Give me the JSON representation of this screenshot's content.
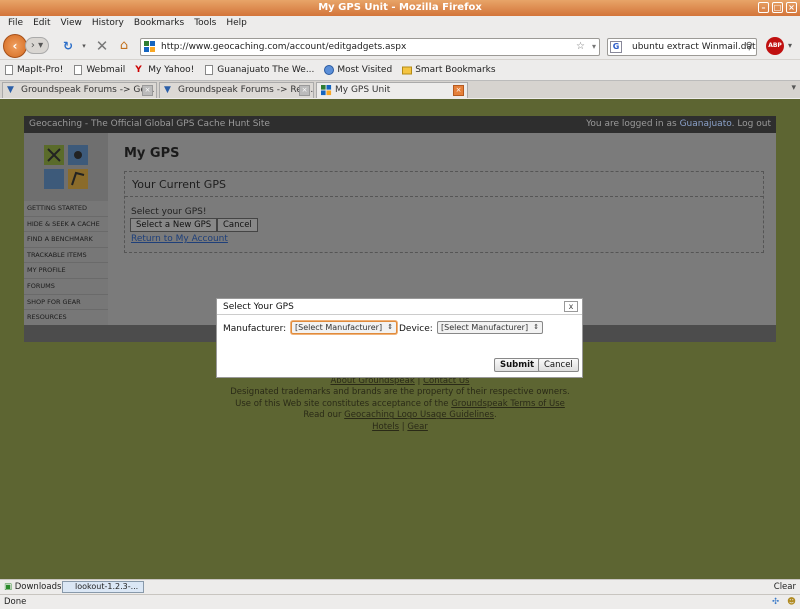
{
  "window": {
    "title": "My GPS Unit - Mozilla Firefox"
  },
  "menu": [
    "File",
    "Edit",
    "View",
    "History",
    "Bookmarks",
    "Tools",
    "Help"
  ],
  "toolbar": {
    "url": "http://www.geocaching.com/account/editgadgets.aspx",
    "search": "ubuntu extract Winmail.dat",
    "abp_label": "ABP"
  },
  "bookmarks": [
    {
      "label": "MapIt-Pro!",
      "icon": "page-icon"
    },
    {
      "label": "Webmail",
      "icon": "page-icon"
    },
    {
      "label": "My Yahoo!",
      "icon": "yahoo-icon"
    },
    {
      "label": "Guanajuato The We...",
      "icon": "page-icon"
    },
    {
      "label": "Most Visited",
      "icon": "globe-icon"
    },
    {
      "label": "Smart Bookmarks",
      "icon": "folder-icon"
    }
  ],
  "tabs": [
    {
      "label": "Groundspeak Forums -> Ge...",
      "active": false
    },
    {
      "label": "Groundspeak Forums -> Rep...",
      "active": false
    },
    {
      "label": "My GPS Unit",
      "active": true
    }
  ],
  "site": {
    "header_left": "Geocaching - The Official Global GPS Cache Hunt Site",
    "header_logged": "You are logged in as",
    "header_user": "Guanajuato",
    "header_logout": "Log out",
    "nav": [
      "GETTING STARTED",
      "HIDE & SEEK A CACHE",
      "FIND A BENCHMARK",
      "TRACKABLE ITEMS",
      "MY PROFILE",
      "FORUMS",
      "SHOP FOR GEAR",
      "RESOURCES"
    ],
    "page_title": "My GPS",
    "box_title": "Your Current GPS",
    "prompt": "Select your GPS!",
    "select_new_btn": "Select a New GPS",
    "cancel_btn": "Cancel",
    "return_link": "Return to My Account"
  },
  "footer": {
    "line1_link1": "About Groundspeak",
    "line1_sep": " | ",
    "line1_link2": "Contact Us",
    "line2": "Designated trademarks and brands are the property of their respective owners.",
    "line3_pre": "Use of this Web site constitutes acceptance of the ",
    "line3_link": "Groundspeak Terms of Use",
    "line4_pre": "Read our ",
    "line4_link": "Geocaching Logo Usage Guidelines",
    "line4_post": ".",
    "line5_link1": "Hotels",
    "line5_link2": "Gear"
  },
  "modal": {
    "title": "Select Your GPS",
    "close": "x",
    "manufacturer_label": "Manufacturer:",
    "manufacturer_value": "[Select Manufacturer]",
    "device_label": "Device:",
    "device_value": "[Select Manufacturer]",
    "submit": "Submit",
    "cancel": "Cancel"
  },
  "downloads": {
    "label": "Downloads",
    "file": "lookout-1.2.3-...",
    "clear": "Clear"
  },
  "status": {
    "text": "Done"
  },
  "colors": {
    "accent": "#d3743a",
    "page_bg": "#5d6532",
    "link": "#1e3f7a"
  }
}
